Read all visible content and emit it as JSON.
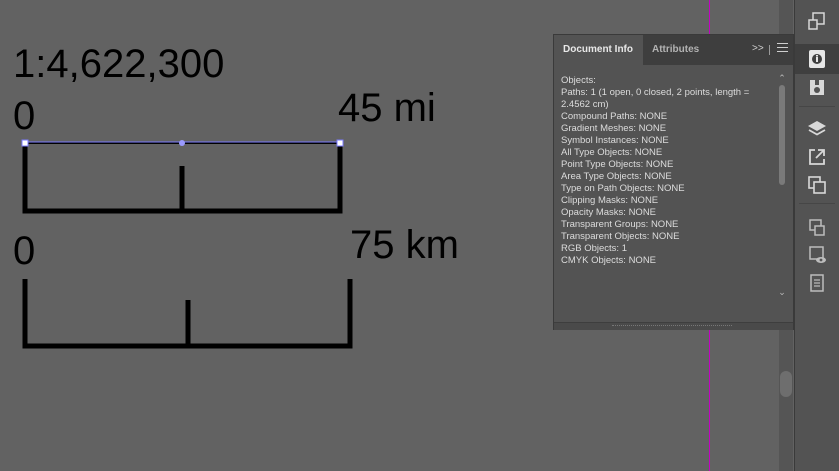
{
  "canvas": {
    "scale_ratio": "1:4,622,300",
    "miles_bar": {
      "zero_label": "0",
      "end_label": "45 mi"
    },
    "km_bar": {
      "zero_label": "0",
      "end_label": "75 km"
    },
    "selection_color": "#7b7bff",
    "guide_color": "#c400c4"
  },
  "panel": {
    "tabs": [
      {
        "label": "Document Info",
        "active": true
      },
      {
        "label": "Attributes",
        "active": false
      }
    ],
    "collapse_label": ">>",
    "lines": [
      "Objects:",
      "",
      "Paths: 1 (1 open, 0 closed, 2 points, length = 2.4562 cm)",
      "Compound Paths: NONE",
      "Gradient Meshes: NONE",
      "Symbol Instances: NONE",
      "",
      "All Type Objects: NONE",
      "Point Type Objects: NONE",
      "Area Type Objects: NONE",
      "Type on Path Objects: NONE",
      "",
      "Clipping Masks: NONE",
      "Opacity Masks: NONE",
      "Transparent Groups: NONE",
      "Transparent Objects: NONE",
      "RGB Objects: 1",
      "CMYK Objects: NONE"
    ]
  },
  "dock": {
    "icons": [
      "artboard-export-icon",
      "document-info-icon",
      "libraries-icon",
      "layers-icon",
      "export-icon",
      "pathfinder-icon",
      "artboards-icon",
      "appearance-icon",
      "properties-icon"
    ]
  }
}
